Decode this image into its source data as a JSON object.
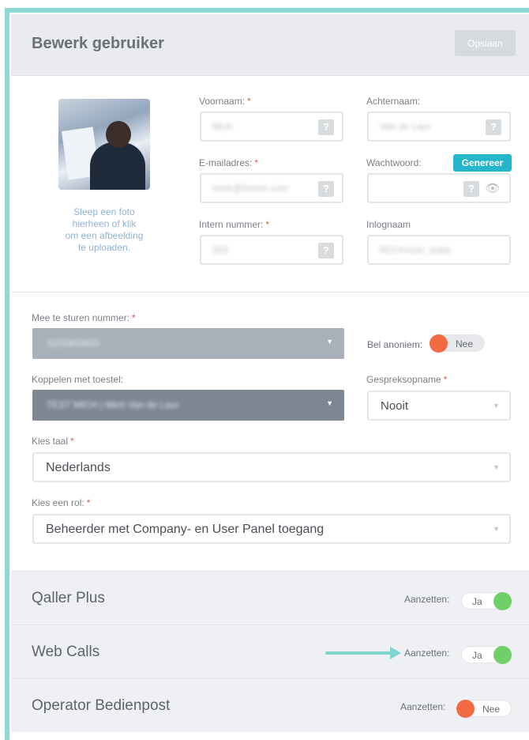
{
  "header": {
    "title": "Bewerk gebruiker",
    "save_label": "Opslaan"
  },
  "avatar": {
    "caption_lines": [
      "Sleep een foto",
      "hierheen of klik",
      "om een afbeelding",
      "te uploaden."
    ]
  },
  "fields": {
    "voornaam": {
      "label": "Voornaam:",
      "required": "*",
      "value": "Mich"
    },
    "achternaam": {
      "label": "Achternaam:",
      "value": "Van de Laur"
    },
    "email": {
      "label": "E-mailadres:",
      "required": "*",
      "value": "mich@fonzer.com"
    },
    "wachtwoord": {
      "label": "Wachtwoord:",
      "generate_label": "Genereer",
      "value": ""
    },
    "intern": {
      "label": "Intern nummer:",
      "required": "*",
      "value": "553"
    },
    "inlognaam": {
      "label": "Inlognaam",
      "value": "553.fonzer_bvba"
    }
  },
  "help_icon": "?",
  "eye_icon": "👁",
  "dropdown_arrow": "▼",
  "routing": {
    "mee_nummer": {
      "label": "Mee te sturen nummer:",
      "required": "*",
      "value": "3225805850"
    },
    "bel_anoniem": {
      "label": "Bel anoniem:",
      "toggle_text": "Nee",
      "on": false
    },
    "koppelen": {
      "label": "Koppelen met toestel:",
      "value": "TEST MICH | Mich Van de Laur"
    },
    "gespreksopname": {
      "label": "Gespreksopname",
      "required": "*",
      "value": "Nooit"
    },
    "taal": {
      "label": "Kies taal",
      "required": "*",
      "value": "Nederlands"
    },
    "rol": {
      "label": "Kies een rol:",
      "required": "*",
      "value": "Beheerder met Company- en User Panel toegang"
    }
  },
  "sections": [
    {
      "title": "Qaller Plus",
      "toggle_label": "Aanzetten:",
      "toggle_text": "Ja",
      "on": true
    },
    {
      "title": "Web Calls",
      "toggle_label": "Aanzetten:",
      "toggle_text": "Ja",
      "on": true
    },
    {
      "title": "Operator Bedienpost",
      "toggle_label": "Aanzetten:",
      "toggle_text": "Nee",
      "on": false
    }
  ],
  "colors": {
    "accent_teal": "#8fd9d4",
    "generate_button": "#25b6cc",
    "toggle_on": "#6fd06a",
    "toggle_off": "#f26a42",
    "required": "#e25a4a",
    "select_dark_1": "#a8b0ba",
    "select_dark_2": "#7d8793"
  }
}
